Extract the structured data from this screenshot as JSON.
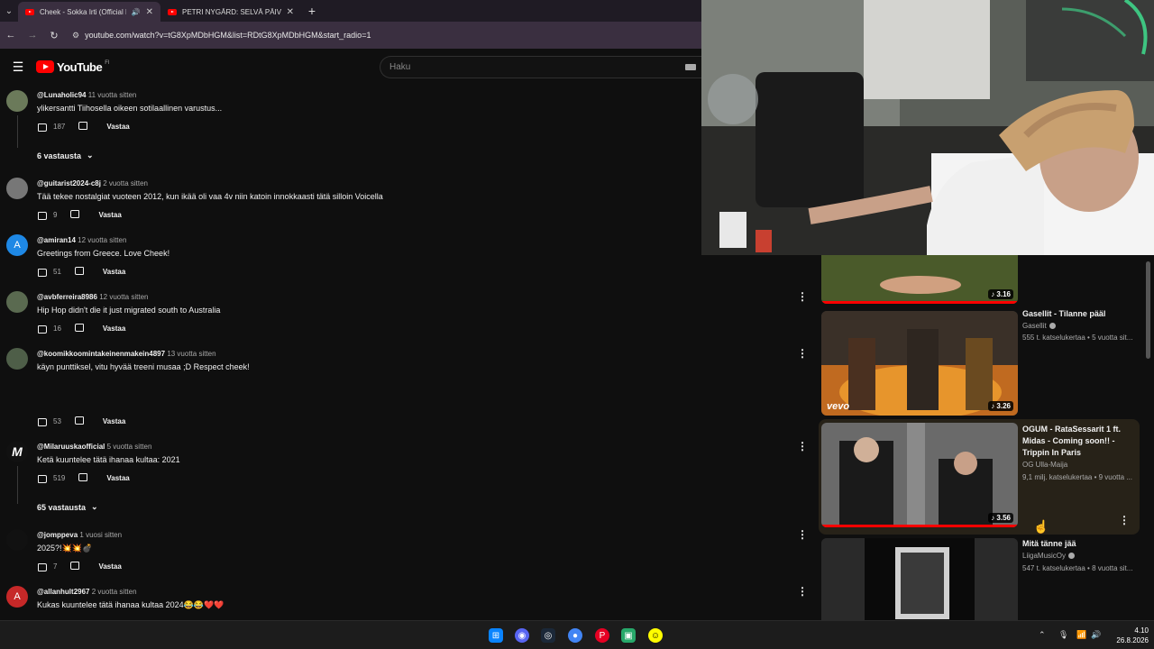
{
  "browser": {
    "tabs": [
      {
        "title": "Cheek - Sokka Irti (Official M",
        "active": true,
        "audio": true
      },
      {
        "title": "PETRI NYGÅRD: SELVÄ PÄIVÄ feat",
        "active": false,
        "audio": false
      }
    ],
    "url": "youtube.com/watch?v=tG8XpMDbHGM&list=RDtG8XpMDbHGM&start_radio=1"
  },
  "youtube": {
    "logo_text": "YouTube",
    "region": "FI",
    "search_placeholder": "Haku"
  },
  "comments": [
    {
      "handle": "@Lunaholic94",
      "time": "11 vuotta sitten",
      "text": "ylikersantti Tiihosella oikeen sotilaallinen varustus...",
      "likes": "187",
      "reply": "Vastaa",
      "replies": "6 vastausta",
      "avatar_color": "#6b7a5a",
      "avatar_letter": ""
    },
    {
      "handle": "@guitarist2024-c8j",
      "time": "2 vuotta sitten",
      "text": "Tää tekee nostalgiat vuoteen 2012, kun ikää oli vaa 4v niin katoin innokkaasti tätä silloin Voicella",
      "likes": "9",
      "reply": "Vastaa",
      "replies": "",
      "avatar_color": "#777777",
      "avatar_letter": ""
    },
    {
      "handle": "@amiran14",
      "time": "12 vuotta sitten",
      "text": "Greetings from Greece. Love Cheek!",
      "likes": "51",
      "reply": "Vastaa",
      "replies": "",
      "avatar_color": "#1e88e5",
      "avatar_letter": "A"
    },
    {
      "handle": "@avbferreira8986",
      "time": "12 vuotta sitten",
      "text": "Hip Hop didn't die it just migrated south to Australia",
      "likes": "16",
      "reply": "Vastaa",
      "replies": "",
      "avatar_color": "#5a6a50",
      "avatar_letter": ""
    },
    {
      "handle": "@koomikkoomintakeinenmakein4897",
      "time": "13 vuotta sitten",
      "text": "käyn punttiksel, vitu hyvää treeni musaa ;D Respect cheek!",
      "likes": "53",
      "reply": "Vastaa",
      "replies": "",
      "avatar_color": "#4e5e48",
      "avatar_letter": ""
    },
    {
      "handle": "@Milaruuskaofficial",
      "time": "5 vuotta sitten",
      "text": "Ketä kuuntelee tätä ihanaa kultaa: 2021",
      "likes": "519",
      "reply": "Vastaa",
      "replies": "65 vastausta",
      "avatar_color": "#111111",
      "avatar_letter": "M"
    },
    {
      "handle": "@jomppeva",
      "time": "1 vuosi sitten",
      "text": "2025?!💥💥💣",
      "likes": "7",
      "reply": "Vastaa",
      "replies": "",
      "avatar_color": "#111111",
      "avatar_letter": ""
    },
    {
      "handle": "@allanhult2967",
      "time": "2 vuotta sitten",
      "text": "Kukas kuuntelee tätä ihanaa kultaa 2024😂😂❤️❤️",
      "likes": "",
      "reply": "Vastaa",
      "replies": "",
      "avatar_color": "#c62828",
      "avatar_letter": "A"
    }
  ],
  "recommendations": [
    {
      "title": "",
      "channel": "",
      "meta": "",
      "duration": "3.16",
      "progress": 1.0,
      "thumb_color": "#3a4a22"
    },
    {
      "title": "Gasellit - Tilanne pääl",
      "channel": "Gasellit",
      "meta": "555 t. katselukertaa • 5 vuotta sit...",
      "duration": "3.26",
      "progress": 1.0,
      "thumb_color": "#8a4a1a",
      "overlay": "vevo"
    },
    {
      "title": "OGUM - RataSessarit 1 ft. Midas - Coming soon!! - Trippin In Paris",
      "channel": "OG Ulla-Maija",
      "meta": "9,1 milj. katselukertaa • 9 vuotta ...",
      "duration": "3.56",
      "progress": 1.0,
      "thumb_color": "#4a4a4a"
    },
    {
      "title": "Mitä tänne jää",
      "channel": "LiigaMusicOy",
      "meta": "547 t. katselukertaa • 8 vuotta sit...",
      "duration": "",
      "progress": 0,
      "thumb_color": "#2a2a2a"
    }
  ],
  "taskbar": {
    "time": "4.10",
    "date": "26.8.2026"
  }
}
